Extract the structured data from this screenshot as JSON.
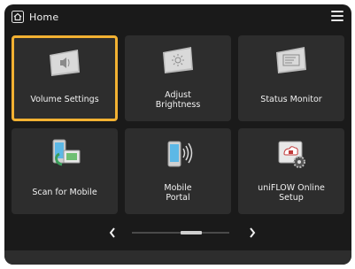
{
  "header": {
    "title": "Home"
  },
  "tiles": [
    {
      "label": "Volume Settings"
    },
    {
      "label": "Adjust\nBrightness"
    },
    {
      "label": "Status Monitor"
    },
    {
      "label": "Scan for Mobile"
    },
    {
      "label": "Mobile\nPortal"
    },
    {
      "label": "uniFLOW Online\nSetup"
    }
  ],
  "icons": {
    "home": "home-icon",
    "menu": "menu-icon",
    "volume": "speaker-icon",
    "brightness": "sun-icon",
    "status": "monitor-icon",
    "scan": "scan-mobile-icon",
    "portal": "phone-wireless-icon",
    "uniflow": "cloud-gear-icon",
    "prev": "chevron-left-icon",
    "next": "chevron-right-icon"
  },
  "colors": {
    "background": "#1a1a1a",
    "tile": "#2d2d2d",
    "selected_border": "#f2b132",
    "text": "#f1f1f1"
  }
}
